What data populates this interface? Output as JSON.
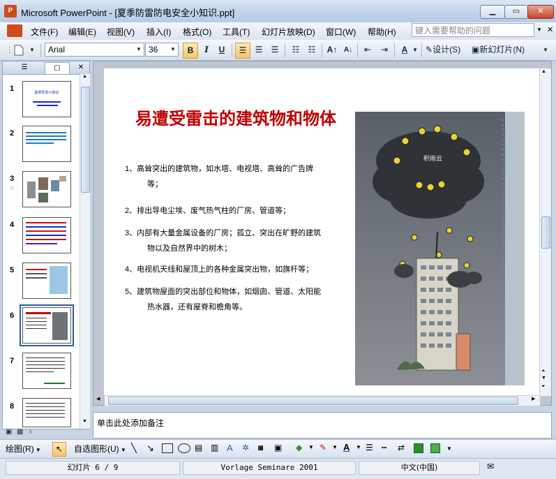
{
  "window": {
    "app_icon_label": "P",
    "title": "Microsoft PowerPoint - [夏季防雷防电安全小知识.ppt]",
    "minimize_label": "▁",
    "maximize_label": "▭",
    "close_label": "✕"
  },
  "menu": {
    "items": [
      "文件(F)",
      "编辑(E)",
      "视图(V)",
      "插入(I)",
      "格式(O)",
      "工具(T)",
      "幻灯片放映(D)",
      "窗口(W)",
      "帮助(H)"
    ],
    "help_placeholder": "键入需要帮助的问题"
  },
  "toolbar": {
    "font_name": "Arial",
    "font_size": "36",
    "bold": "B",
    "italic": "I",
    "underline": "U",
    "design_label": "设计(S)",
    "new_slide_label": "新幻灯片(N)"
  },
  "panel": {
    "tab_outline_icon": "outline-icon",
    "tab_slides_icon": "slides-icon",
    "close_label": "✕",
    "slides": [
      {
        "num": "1"
      },
      {
        "num": "2"
      },
      {
        "num": "3"
      },
      {
        "num": "4"
      },
      {
        "num": "5"
      },
      {
        "num": "6"
      },
      {
        "num": "7"
      },
      {
        "num": "8"
      }
    ],
    "thumb1_title": "夏季防雷小知识"
  },
  "slide": {
    "title": "易遭受雷击的建筑物和物体",
    "bullets": [
      {
        "lead": "1、高耸突出的建筑物，如水塔、电视塔、高耸的广告牌",
        "cont": "等；"
      },
      {
        "lead": "2、排出导电尘埃、废气热气柱的厂房、管道等；",
        "cont": ""
      },
      {
        "lead": "3、内部有大量金属设备的厂房；孤立、突出在旷野的建筑",
        "cont": "物以及自然界中的树木；"
      },
      {
        "lead": "4、电视机天线和屋顶上的各种金属突出物，如旗杆等；",
        "cont": ""
      },
      {
        "lead": "5、建筑物屋面的突出部位和物体，如烟囱、管道、太阳能",
        "cont": "热水器，还有屋脊和檐角等。"
      }
    ],
    "cloud_label": "积雨云"
  },
  "notes": {
    "placeholder": "单击此处添加备注"
  },
  "drawbar": {
    "draw_label": "绘图(R)",
    "autoshape_label": "自选图形(U)"
  },
  "status": {
    "slide_pos": "幻灯片 6 / 9",
    "design": "Vorlage Seminare 2001",
    "language": "中文(中国)"
  },
  "colors": {
    "title_red": "#c00000",
    "active_outline": "#2d5aa0"
  }
}
